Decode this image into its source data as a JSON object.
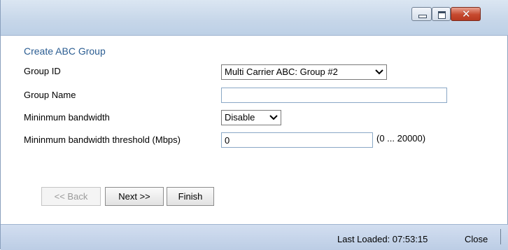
{
  "window": {
    "controls": {
      "minimize": "minimize-icon",
      "maximize": "maximize-icon",
      "close": "close-icon",
      "close_glyph": "✕"
    }
  },
  "form": {
    "title": "Create ABC Group",
    "group_id": {
      "label": "Group ID",
      "value": "Multi Carrier ABC: Group #2"
    },
    "group_name": {
      "label": "Group Name",
      "value": ""
    },
    "min_bandwidth": {
      "label": "Mininmum bandwidth",
      "value": "Disable"
    },
    "min_bandwidth_threshold": {
      "label": "Mininmum bandwidth threshold (Mbps)",
      "value": "0",
      "range": "(0 ... 20000)"
    }
  },
  "buttons": {
    "back": "<< Back",
    "next": "Next >>",
    "finish": "Finish"
  },
  "footer": {
    "last_loaded": "Last Loaded: 07:53:15",
    "close": "Close"
  },
  "colors": {
    "title_text": "#2b5d92",
    "titlebar": "#c6d6e9",
    "footer": "#bccde5"
  }
}
